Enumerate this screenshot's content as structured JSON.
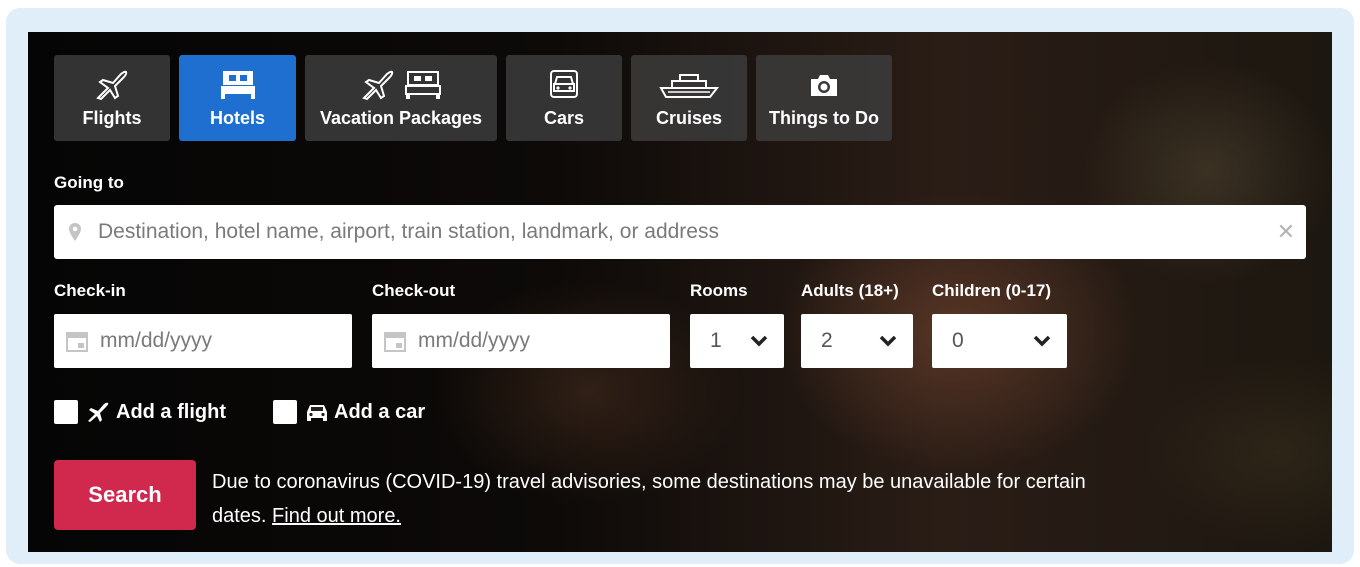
{
  "tabs": [
    {
      "label": "Flights",
      "icons": [
        "plane-icon"
      ]
    },
    {
      "label": "Hotels",
      "icons": [
        "bed-icon"
      ]
    },
    {
      "label": "Vacation Packages",
      "icons": [
        "plane-icon",
        "bed-icon"
      ]
    },
    {
      "label": "Cars",
      "icons": [
        "car-icon"
      ]
    },
    {
      "label": "Cruises",
      "icons": [
        "ship-icon"
      ]
    },
    {
      "label": "Things to Do",
      "icons": [
        "camera-icon"
      ]
    }
  ],
  "active_tab": "Hotels",
  "colors": {
    "active_tab": "#1f6fd0",
    "search_button": "#d1284d"
  },
  "destination": {
    "label": "Going to",
    "placeholder": "Destination, hotel name, airport, train station, landmark, or address",
    "value": "",
    "clear_icon": "close-icon",
    "pin_icon": "map-pin-icon"
  },
  "checkin": {
    "label": "Check-in",
    "placeholder": "mm/dd/yyyy",
    "icon": "calendar-icon"
  },
  "checkout": {
    "label": "Check-out",
    "placeholder": "mm/dd/yyyy",
    "icon": "calendar-icon"
  },
  "rooms": {
    "label": "Rooms",
    "value": "1"
  },
  "adults": {
    "label": "Adults (18+)",
    "value": "2"
  },
  "children": {
    "label": "Children (0-17)",
    "value": "0"
  },
  "add_flight": {
    "label": "Add a flight",
    "checked": false,
    "icon": "plane-icon"
  },
  "add_car": {
    "label": "Add a car",
    "checked": false,
    "icon": "car-icon"
  },
  "search_button": {
    "label": "Search"
  },
  "notice": {
    "text": "Due to coronavirus (COVID-19) travel advisories, some destinations may be unavailable for certain dates.",
    "link": "Find out more."
  }
}
